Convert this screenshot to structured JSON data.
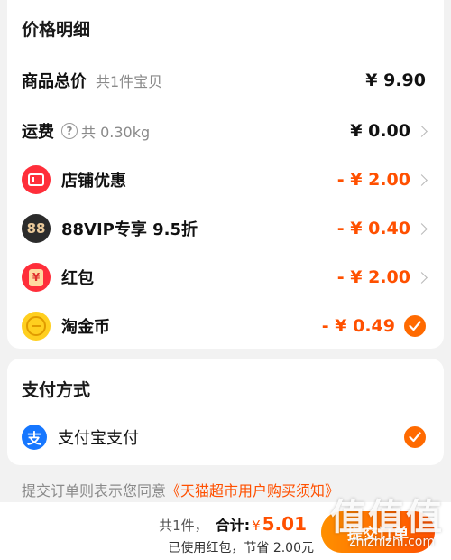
{
  "price_card": {
    "title": "价格明细",
    "subtotal": {
      "label": "商品总价",
      "note": "共1件宝贝",
      "amount": "¥ 9.90"
    },
    "shipping": {
      "label": "运费",
      "note": "共 0.30kg",
      "amount": "¥ 0.00"
    },
    "store_discount": {
      "label": "店铺优惠",
      "amount": "- ¥ 2.00",
      "icon": "coupon-ticket-icon"
    },
    "vip_discount": {
      "label": "88VIP专享 9.5折",
      "amount": "- ¥ 0.40",
      "icon_text": "88"
    },
    "red_packet": {
      "label": "红包",
      "amount": "- ¥ 2.00",
      "icon_text": "¥"
    },
    "taojinbi": {
      "label": "淘金币",
      "amount": "- ¥ 0.49",
      "checked": true
    }
  },
  "pay_card": {
    "title": "支付方式",
    "method": {
      "label": "支付宝支付",
      "icon_text": "支",
      "checked": true
    }
  },
  "terms": {
    "prefix": "提交订单则表示您同意",
    "link": "《天猫超市用户购买须知》"
  },
  "bottom_bar": {
    "count": "共1件，",
    "total_label": "合计:",
    "currency": "¥",
    "total": "5.01",
    "savings": "已使用红包，节省 2.00元",
    "submit_label": "提交订单"
  },
  "watermark": {
    "text": "值值值",
    "url": "zhizhizhi.com"
  },
  "colors": {
    "accent": "#ff5000",
    "vip_dark": "#2b2b2b",
    "alipay_blue": "#1677ff",
    "coin_gold": "#f5b800"
  }
}
